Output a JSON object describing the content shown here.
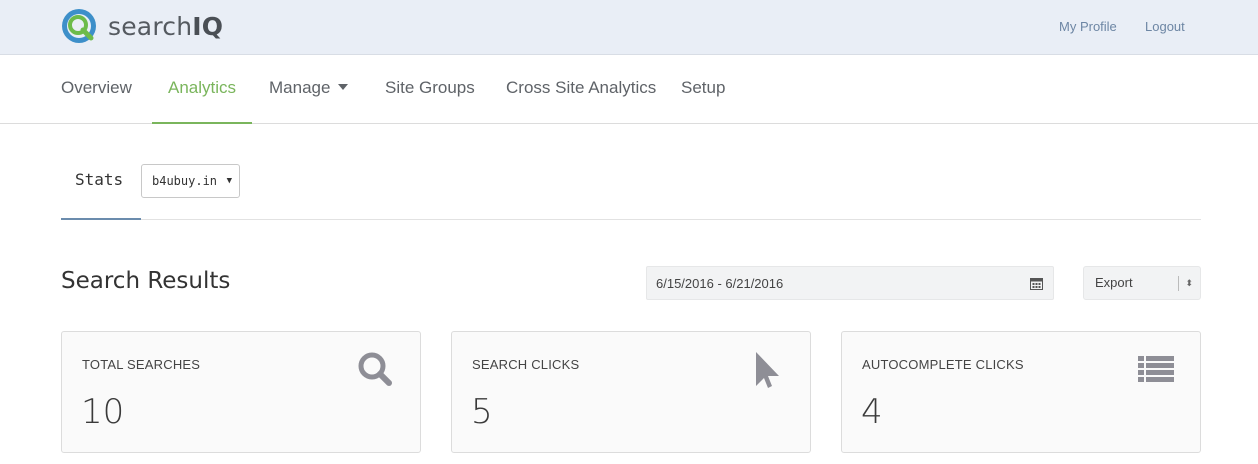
{
  "brand": {
    "name_light": "search",
    "name_bold": "IQ"
  },
  "topbar": {
    "my_profile": "My Profile",
    "logout": "Logout"
  },
  "nav": {
    "items": [
      "Overview",
      "Analytics",
      "Manage",
      "Site Groups",
      "Cross Site Analytics",
      "Setup"
    ],
    "active": "Analytics"
  },
  "stats": {
    "tab_label": "Stats",
    "site_selected": "b4ubuy.in"
  },
  "section": {
    "title": "Search Results",
    "date_range": "6/15/2016 - 6/21/2016",
    "export_label": "Export"
  },
  "cards": [
    {
      "label": "TOTAL SEARCHES",
      "value": "10",
      "icon": "search-icon"
    },
    {
      "label": "SEARCH CLICKS",
      "value": "5",
      "icon": "cursor-icon"
    },
    {
      "label": "AUTOCOMPLETE CLICKS",
      "value": "4",
      "icon": "list-icon"
    }
  ],
  "colors": {
    "accent": "#7ab55c",
    "topbar_bg": "#e9eef6",
    "link": "#6d86a4",
    "icon_gray": "#8e8e96"
  }
}
